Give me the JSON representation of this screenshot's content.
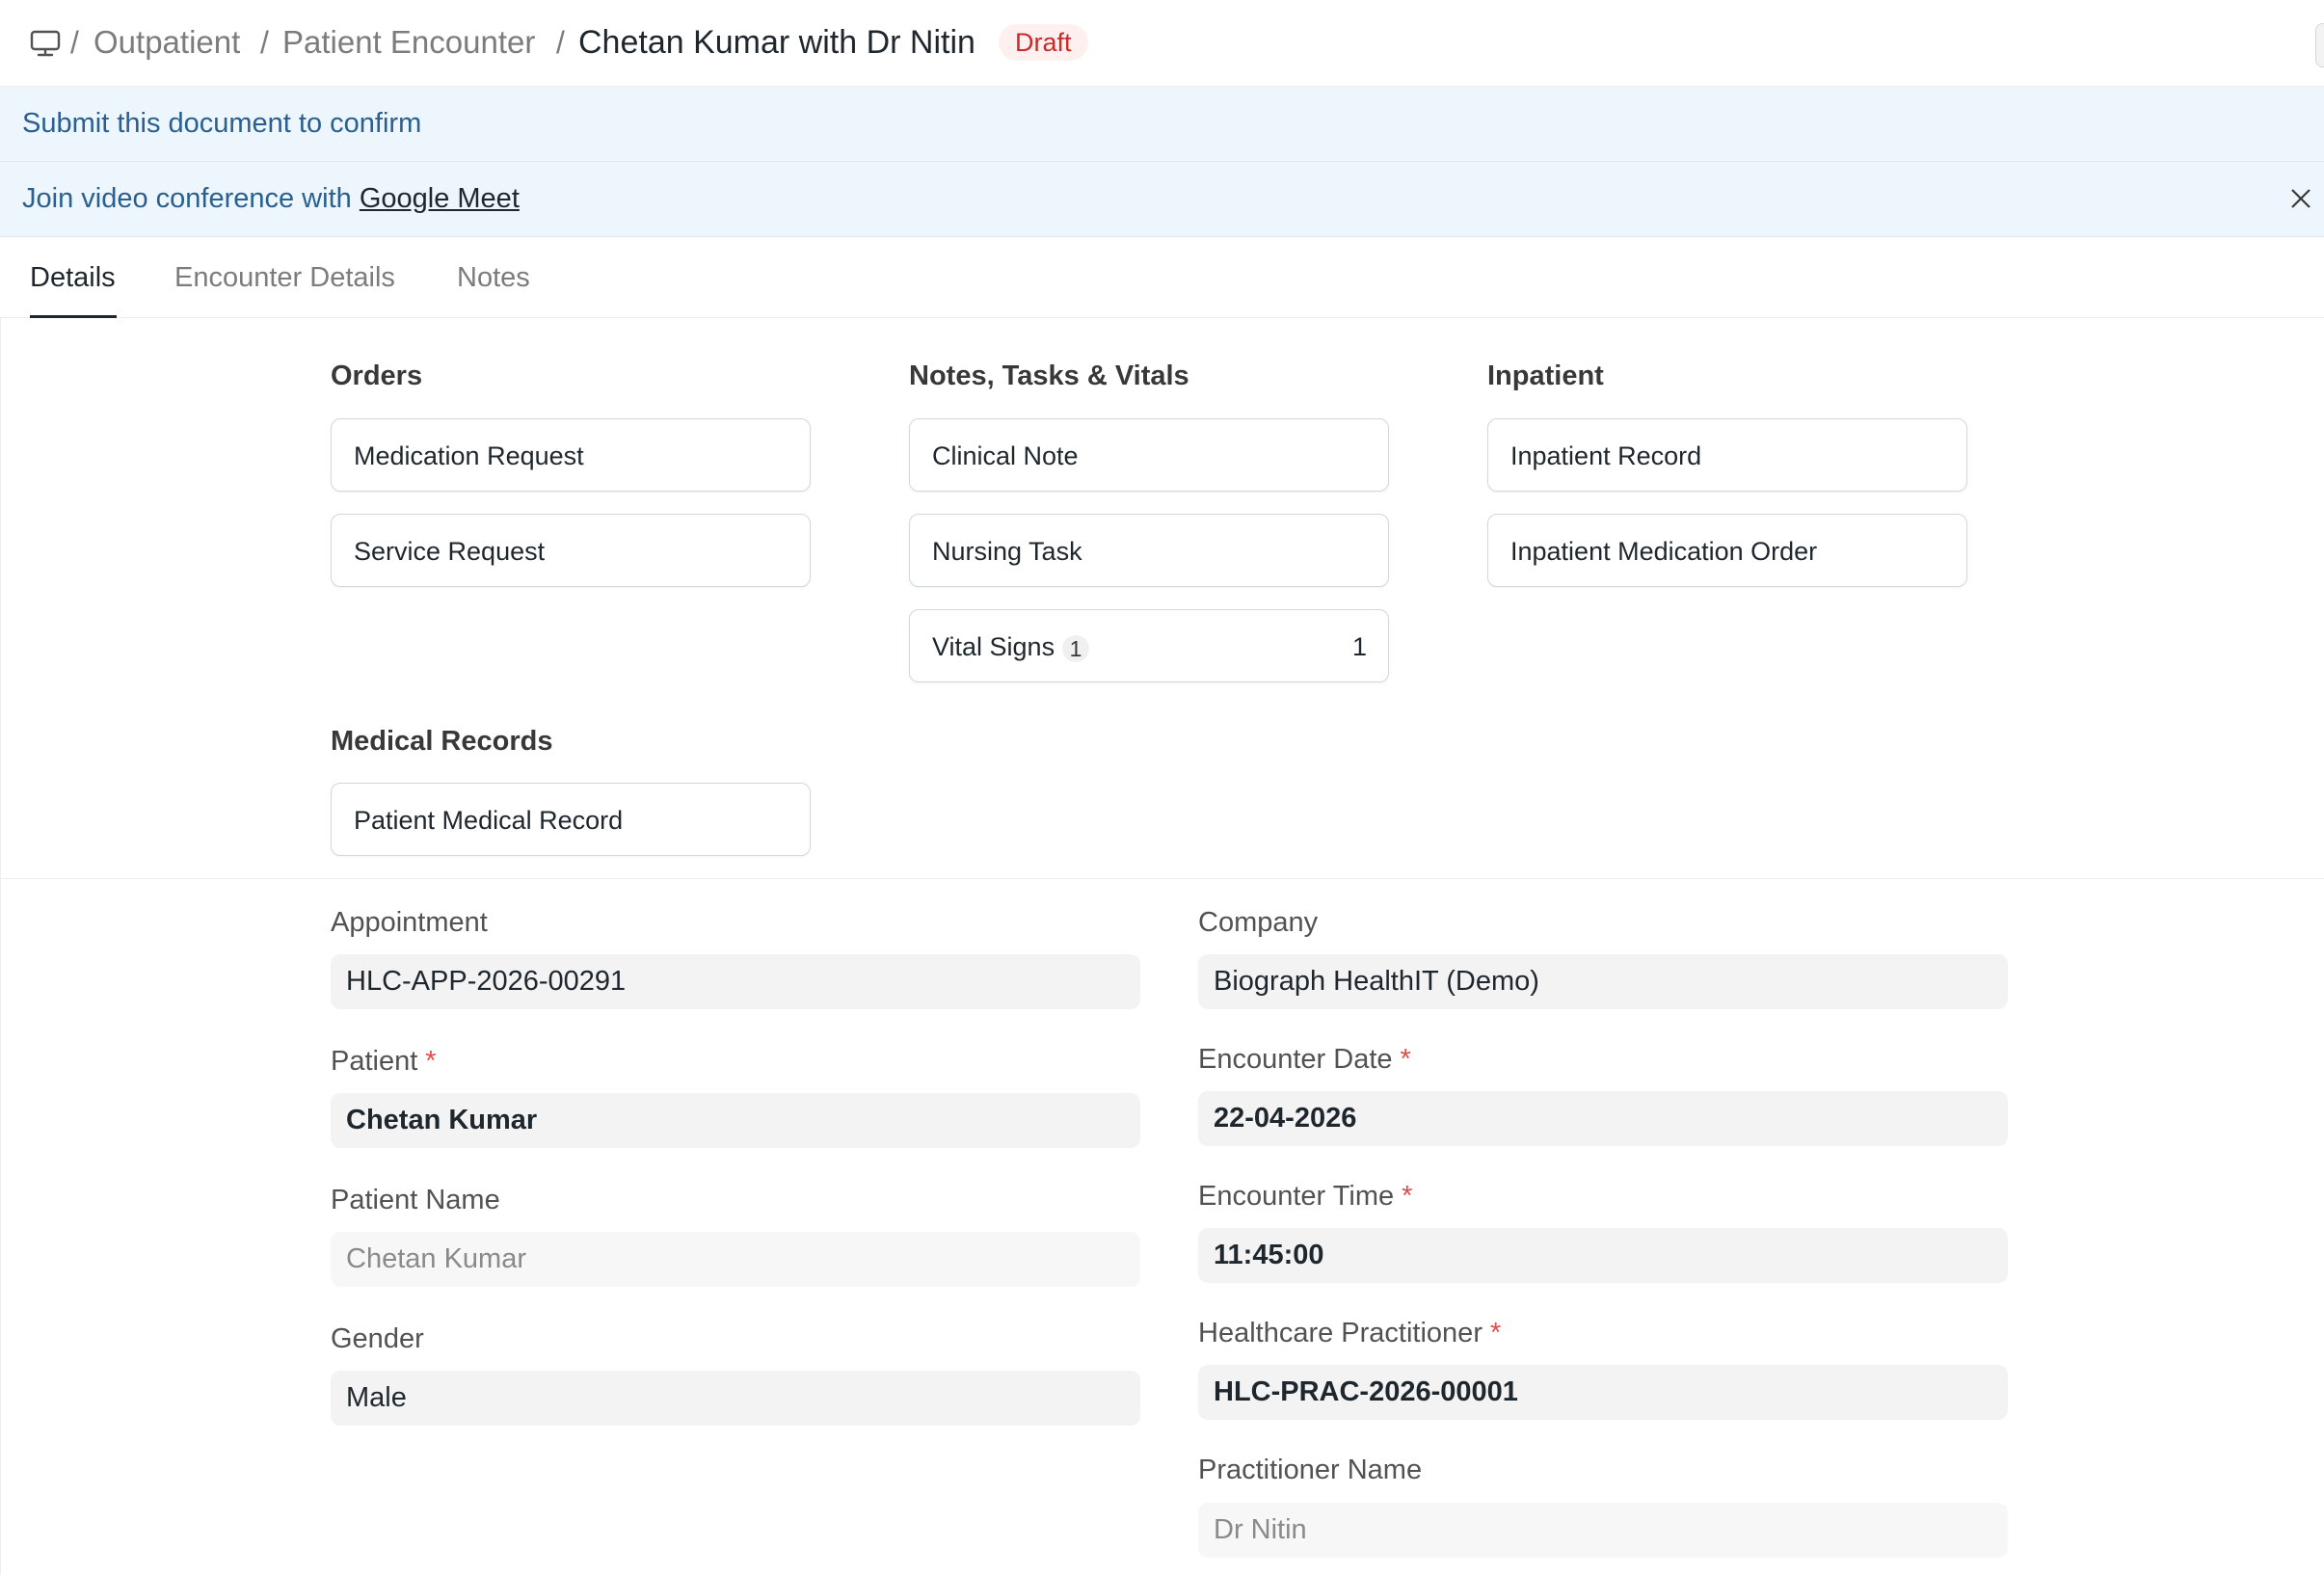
{
  "breadcrumb": {
    "icon": "monitor-icon",
    "separator": "/",
    "items": [
      "Outpatient",
      "Patient Encounter"
    ],
    "title": "Chetan Kumar with Dr Nitin",
    "status": "Draft"
  },
  "banners": {
    "submit": "Submit this document to confirm",
    "video_prefix": "Join video conference with",
    "video_link": "Google Meet"
  },
  "tabs": [
    {
      "label": "Details",
      "active": true
    },
    {
      "label": "Encounter Details",
      "active": false
    },
    {
      "label": "Notes",
      "active": false
    }
  ],
  "connections": {
    "orders": {
      "title": "Orders",
      "items": [
        "Medication Request",
        "Service Request"
      ]
    },
    "notes": {
      "title": "Notes, Tasks & Vitals",
      "items": [
        "Clinical Note",
        "Nursing Task",
        "Vital Signs"
      ],
      "vital_count": "1"
    },
    "inpatient": {
      "title": "Inpatient",
      "items": [
        "Inpatient Record",
        "Inpatient Medication Order"
      ]
    },
    "medical": {
      "title": "Medical Records",
      "items": [
        "Patient Medical Record"
      ]
    }
  },
  "form": {
    "appointment": {
      "label": "Appointment",
      "value": "HLC-APP-2026-00291"
    },
    "patient": {
      "label": "Patient",
      "value": "Chetan Kumar"
    },
    "patient_name": {
      "label": "Patient Name",
      "value": "Chetan Kumar"
    },
    "gender": {
      "label": "Gender",
      "value": "Male"
    },
    "company": {
      "label": "Company",
      "value": "Biograph HealthIT (Demo)"
    },
    "encounter_date": {
      "label": "Encounter Date",
      "value": "22-04-2026"
    },
    "encounter_time": {
      "label": "Encounter Time",
      "value": "11:45:00"
    },
    "practitioner": {
      "label": "Healthcare Practitioner",
      "value": "HLC-PRAC-2026-00001"
    },
    "practitioner_name": {
      "label": "Practitioner Name",
      "value": "Dr Nitin"
    },
    "required_mark": "*"
  },
  "colors": {
    "accent_text": "#2a5f91",
    "banner_bg": "#edf6fd",
    "draft": "#cc2929",
    "required": "#e24c4c"
  }
}
